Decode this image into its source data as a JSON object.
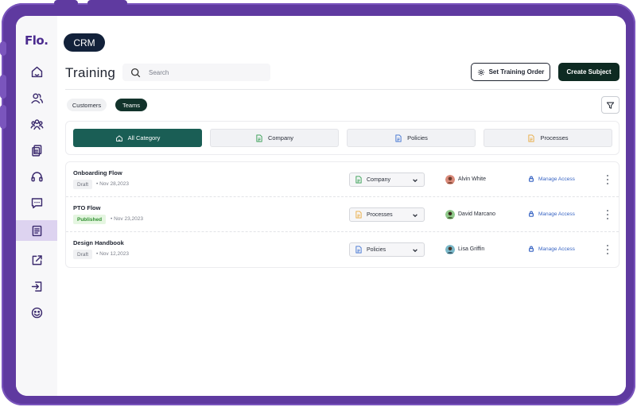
{
  "app": {
    "logo": "Flo.",
    "section_pill": "CRM"
  },
  "sidebar": {
    "items": [
      {
        "icon": "home-icon"
      },
      {
        "icon": "users-icon"
      },
      {
        "icon": "team-icon"
      },
      {
        "icon": "documents-icon"
      },
      {
        "icon": "headset-icon"
      },
      {
        "icon": "chat-icon"
      },
      {
        "icon": "training-icon",
        "active": true
      },
      {
        "icon": "external-link-icon"
      },
      {
        "icon": "login-icon"
      },
      {
        "icon": "emoji-icon"
      }
    ]
  },
  "header": {
    "title": "Training",
    "search_placeholder": "Search",
    "set_order_label": "Set Training Order",
    "create_label": "Create Subject"
  },
  "tabs": {
    "customers": "Customers",
    "teams": "Teams",
    "active": "Teams"
  },
  "categories": {
    "all": "All Category",
    "company": "Company",
    "policies": "Policies",
    "processes": "Processes",
    "active": "All Category"
  },
  "colors": {
    "frame": "#5f3aa0",
    "primary_dark": "#0e2a22",
    "active_category": "#1a5e55",
    "published_text": "#2f8f2f",
    "link": "#3a66c4",
    "company_icon": "#2e9b4c",
    "policies_icon": "#3a6fd0",
    "processes_icon": "#e8a83a"
  },
  "flows": [
    {
      "name": "Onboarding Flow",
      "status": "Draft",
      "date": "Nov 28,2023",
      "category": "Company",
      "owner": "Alvin White",
      "manage_label": "Manage Access"
    },
    {
      "name": "PTO Flow",
      "status": "Published",
      "date": "Nov 23,2023",
      "category": "Processes",
      "owner": "David Marcano",
      "manage_label": "Manage Access"
    },
    {
      "name": "Design Handbook",
      "status": "Draft",
      "date": "Nov 12,2023",
      "category": "Policies",
      "owner": "Lisa Griffin",
      "manage_label": "Manage Access"
    }
  ]
}
